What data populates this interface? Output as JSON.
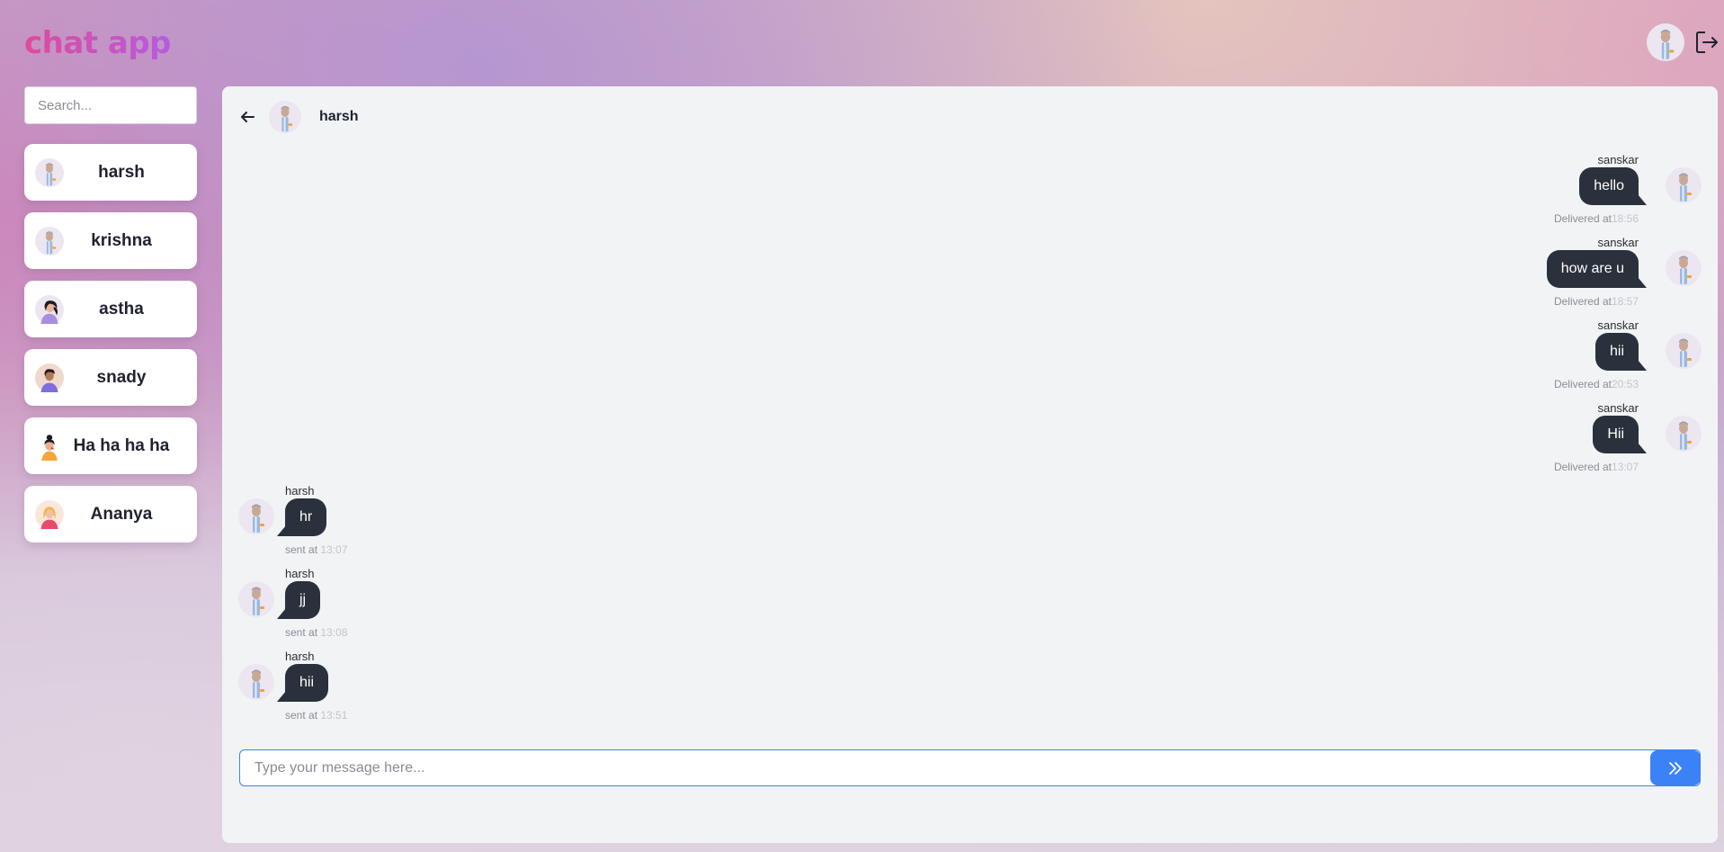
{
  "app": {
    "title": "chat app"
  },
  "colors": {
    "accent": "#3b82f6",
    "bubble": "#2a303c",
    "logo_start": "#e04a9a",
    "logo_end": "#b65be0"
  },
  "topbar": {
    "avatar_icon": "user-avatar-man",
    "logout_icon": "logout-icon"
  },
  "search": {
    "placeholder": "Search...",
    "icon": "search-icon"
  },
  "contacts": [
    {
      "name": "harsh",
      "avatar": "avatar-man-grey"
    },
    {
      "name": "krishna",
      "avatar": "avatar-man-grey"
    },
    {
      "name": "astha",
      "avatar": "avatar-woman-darkhair"
    },
    {
      "name": "snady",
      "avatar": "avatar-man-brown"
    },
    {
      "name": "Ha ha ha ha",
      "avatar": "avatar-woman-bun"
    },
    {
      "name": "Ananya",
      "avatar": "avatar-woman-blonde"
    }
  ],
  "chat": {
    "name": "harsh",
    "back_icon": "back-arrow-icon",
    "messages": [
      {
        "direction": "out",
        "sender": "sanskar",
        "text": "hello",
        "status": "Delivered at",
        "time": "18:56"
      },
      {
        "direction": "out",
        "sender": "sanskar",
        "text": "how are u",
        "status": "Delivered at",
        "time": "18:57"
      },
      {
        "direction": "out",
        "sender": "sanskar",
        "text": "hii",
        "status": "Delivered at",
        "time": "20:53"
      },
      {
        "direction": "out",
        "sender": "sanskar",
        "text": "Hii",
        "status": "Delivered at",
        "time": "13:07"
      },
      {
        "direction": "in",
        "sender": "harsh",
        "text": "hr",
        "status": "sent at",
        "time": "13:07"
      },
      {
        "direction": "in",
        "sender": "harsh",
        "text": "jj",
        "status": "sent at",
        "time": "13:08"
      },
      {
        "direction": "in",
        "sender": "harsh",
        "text": "hii",
        "status": "sent at",
        "time": "13:51"
      }
    ]
  },
  "composer": {
    "placeholder": "Type your message here...",
    "send_icon": "double-chevron-right-icon"
  }
}
